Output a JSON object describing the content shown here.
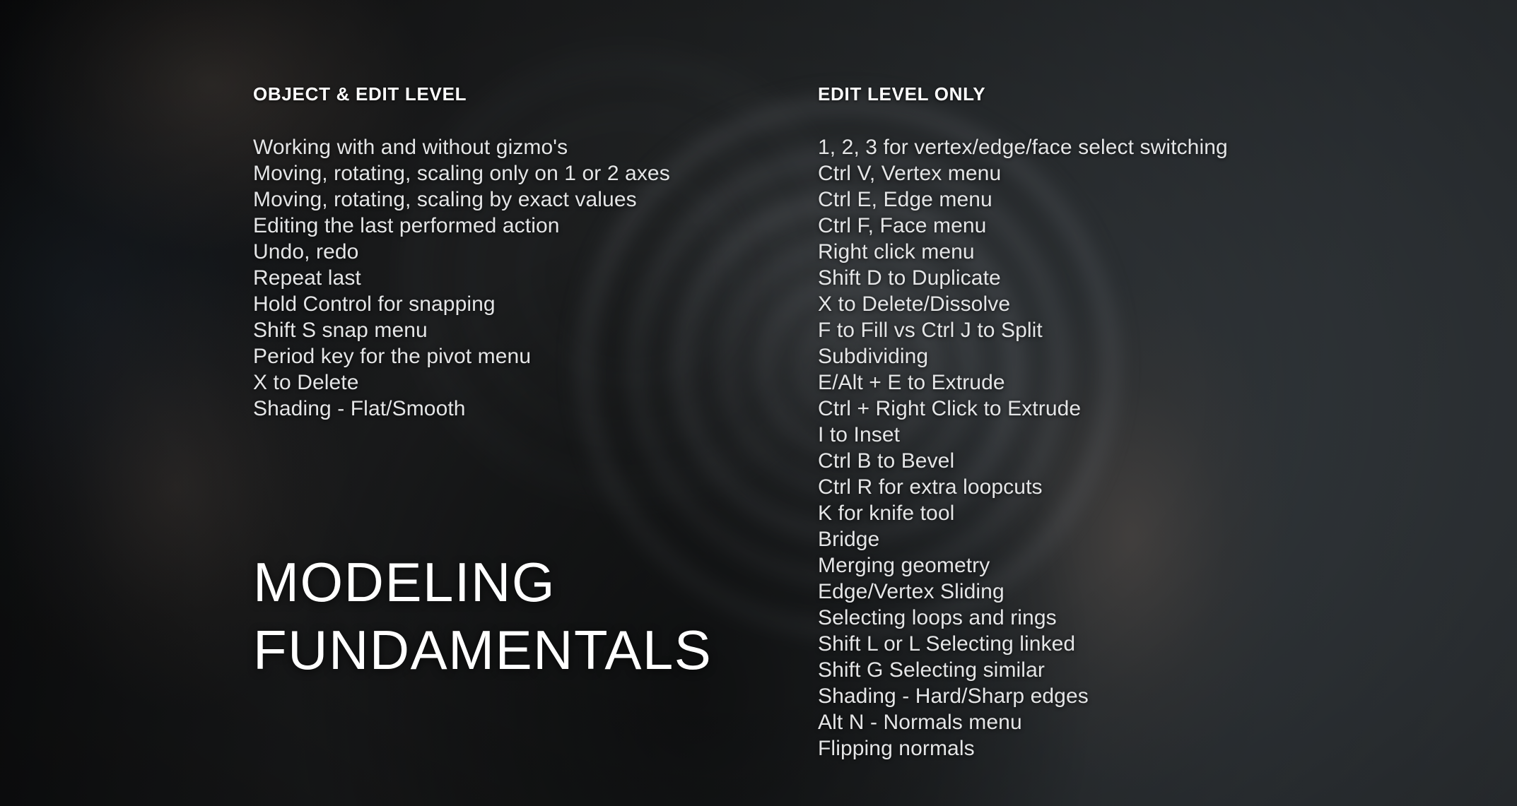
{
  "slide": {
    "title_line_1": "MODELING",
    "title_line_2": "FUNDAMENTALS",
    "background_color": "#17191a",
    "accent_text_color": "#e4e5e6",
    "heading_color": "#ffffff"
  },
  "columns": {
    "left": {
      "header": "OBJECT & EDIT LEVEL",
      "items": [
        "Working with and without gizmo's",
        "Moving, rotating, scaling only on 1 or 2 axes",
        "Moving, rotating, scaling by exact values",
        "Editing the last performed action",
        "Undo, redo",
        "Repeat last",
        "Hold Control for snapping",
        "Shift S snap menu",
        "Period key for the pivot menu",
        "X to Delete",
        "Shading - Flat/Smooth"
      ]
    },
    "right": {
      "header": "EDIT LEVEL ONLY",
      "items": [
        "1, 2, 3 for vertex/edge/face select switching",
        "Ctrl V, Vertex menu",
        "Ctrl E, Edge menu",
        "Ctrl F, Face menu",
        "Right click menu",
        "Shift D to Duplicate",
        "X to Delete/Dissolve",
        "F to Fill vs Ctrl J to Split",
        "Subdividing",
        "E/Alt + E to Extrude",
        "Ctrl + Right Click to Extrude",
        "I to Inset",
        "Ctrl B to Bevel",
        "Ctrl R for extra loopcuts",
        "K for knife tool",
        "Bridge",
        "Merging geometry",
        "Edge/Vertex Sliding",
        "Selecting loops and rings",
        "Shift L or L Selecting linked",
        "Shift G Selecting similar",
        "Shading - Hard/Sharp edges",
        "Alt N - Normals menu",
        "Flipping normals"
      ]
    }
  }
}
